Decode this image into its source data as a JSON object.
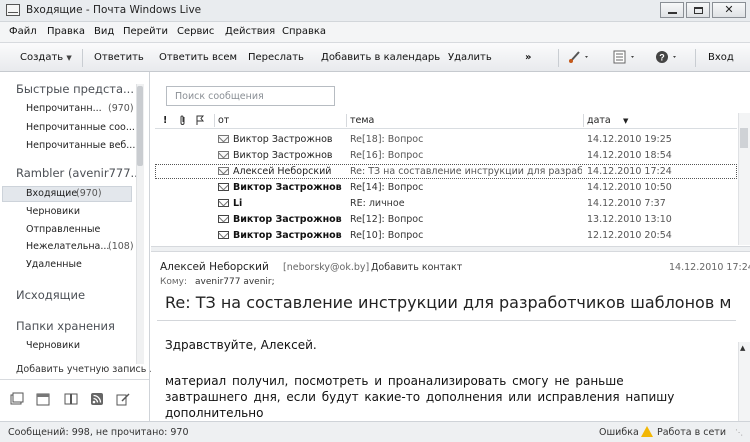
{
  "window": {
    "title": "Входящие - Почта Windows Live",
    "min_glyph": "",
    "close_glyph": "✕"
  },
  "menu": [
    "Файл",
    "Правка",
    "Вид",
    "Перейти",
    "Сервис",
    "Действия",
    "Справка"
  ],
  "toolbar": {
    "create": "Создать",
    "reply": "Ответить",
    "reply_all": "Ответить всем",
    "forward": "Переслать",
    "add_calendar": "Добавить в календарь",
    "delete": "Удалить",
    "more": "»",
    "signin": "Вход"
  },
  "sidebar": {
    "quick_views_header": "Быстрые предста...",
    "quick_views": [
      {
        "label": "Непрочитанн...",
        "count": "(970)"
      },
      {
        "label": "Непрочитанные соо...",
        "count": ""
      },
      {
        "label": "Непрочитанные веб...",
        "count": ""
      }
    ],
    "account_header": "Rambler (avenir777...",
    "account_items": [
      {
        "label": "Входящие",
        "count": "(970)"
      },
      {
        "label": "Черновики",
        "count": ""
      },
      {
        "label": "Отправленные",
        "count": ""
      },
      {
        "label": "Нежелательна...",
        "count": "(108)"
      },
      {
        "label": "Удаленные",
        "count": ""
      }
    ],
    "outbox_header": "Исходящие",
    "storage_header": "Папки хранения",
    "storage_items": [
      {
        "label": "Черновики",
        "count": ""
      }
    ],
    "add_account": "Добавить учетную запись ...",
    "bottom_icons": [
      "mail-icon",
      "calendar-icon",
      "contacts-icon",
      "feeds-icon",
      "newsgroups-icon"
    ]
  },
  "search": {
    "placeholder": "Поиск сообщения"
  },
  "list": {
    "columns": {
      "importance": "!",
      "attachment": "",
      "flag": "",
      "from": "от",
      "subject": "тема",
      "date": "дата",
      "sort": "▼"
    },
    "rows": [
      {
        "from": "Виктор Застрожнов",
        "subject": "Re[18]: Вопрос",
        "date": "14.12.2010 19:25",
        "unread": false,
        "selected": false
      },
      {
        "from": "Виктор Застрожнов",
        "subject": "Re[16]: Вопрос",
        "date": "14.12.2010 18:54",
        "unread": false,
        "selected": false
      },
      {
        "from": "Алексей Неборский",
        "subject": "Re: ТЗ на составление инструкции для разраб...",
        "date": "14.12.2010 17:24",
        "unread": false,
        "selected": true
      },
      {
        "from": "Виктор Застрожнов",
        "subject": "Re[14]: Вопрос",
        "date": "14.12.2010 10:50",
        "unread": true,
        "selected": false
      },
      {
        "from": "Li",
        "subject": "RE: личное",
        "date": "14.12.2010 7:37",
        "unread": true,
        "selected": false
      },
      {
        "from": "Виктор Застрожнов",
        "subject": "Re[12]: Вопрос",
        "date": "13.12.2010 13:10",
        "unread": true,
        "selected": false
      },
      {
        "from": "Виктор Застрожнов",
        "subject": "Re[10]: Вопрос",
        "date": "12.12.2010 20:54",
        "unread": true,
        "selected": false
      }
    ]
  },
  "reading": {
    "from": "Алексей Неборский",
    "email": "[neborsky@ok.by]",
    "add_contact": "Добавить контакт",
    "date": "14.12.2010 17:24",
    "to_label": "Кому:",
    "to": "avenir777 avenir;",
    "subject": "Re: ТЗ на составление инструкции для разработчиков шаблонов м",
    "greeting": "Здравствуйте, Алексей.",
    "body_lines": [
      "материал получил, посмотреть и проанализировать смогу не раньше",
      "завтрашнего дня, если будут какие-то дополнения или исправления напишу",
      "дополнительно"
    ]
  },
  "status": {
    "left": "Сообщений: 998, не прочитано: 970",
    "error": "Ошибка",
    "online": "Работа в сети",
    "warning_color": "#f2b705"
  }
}
